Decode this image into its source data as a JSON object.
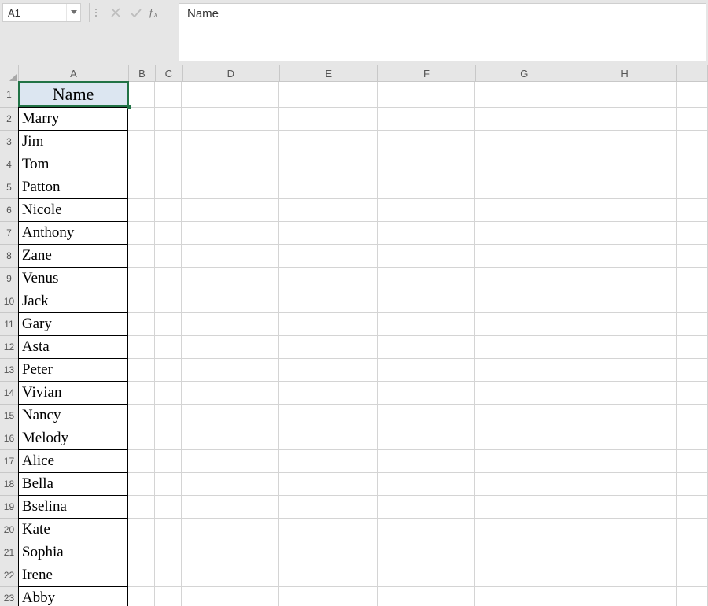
{
  "name_box": {
    "value": "A1"
  },
  "formula_bar": {
    "value": "Name"
  },
  "columns": [
    {
      "label": "A",
      "class": "col-A"
    },
    {
      "label": "B",
      "class": "col-B"
    },
    {
      "label": "C",
      "class": "col-C"
    },
    {
      "label": "D",
      "class": "col-D"
    },
    {
      "label": "E",
      "class": "col-E"
    },
    {
      "label": "F",
      "class": "col-F"
    },
    {
      "label": "G",
      "class": "col-G"
    },
    {
      "label": "H",
      "class": "col-H"
    },
    {
      "label": "",
      "class": "col-I"
    }
  ],
  "active_cell": {
    "ref": "A1",
    "col": "A",
    "row": 1
  },
  "header_row": {
    "num": 1,
    "A": "Name"
  },
  "data_rows": [
    {
      "num": 2,
      "A": "Marry"
    },
    {
      "num": 3,
      "A": "Jim"
    },
    {
      "num": 4,
      "A": "Tom"
    },
    {
      "num": 5,
      "A": "Patton"
    },
    {
      "num": 6,
      "A": "Nicole"
    },
    {
      "num": 7,
      "A": "Anthony"
    },
    {
      "num": 8,
      "A": "Zane"
    },
    {
      "num": 9,
      "A": "Venus"
    },
    {
      "num": 10,
      "A": "Jack"
    },
    {
      "num": 11,
      "A": "Gary"
    },
    {
      "num": 12,
      "A": "Asta"
    },
    {
      "num": 13,
      "A": "Peter"
    },
    {
      "num": 14,
      "A": "Vivian"
    },
    {
      "num": 15,
      "A": "Nancy"
    },
    {
      "num": 16,
      "A": "Melody"
    },
    {
      "num": 17,
      "A": "Alice"
    },
    {
      "num": 18,
      "A": "Bella"
    },
    {
      "num": 19,
      "A": "Bselina"
    },
    {
      "num": 20,
      "A": "Kate"
    },
    {
      "num": 21,
      "A": "Sophia"
    },
    {
      "num": 22,
      "A": "Irene"
    },
    {
      "num": 23,
      "A": "Abby"
    }
  ]
}
